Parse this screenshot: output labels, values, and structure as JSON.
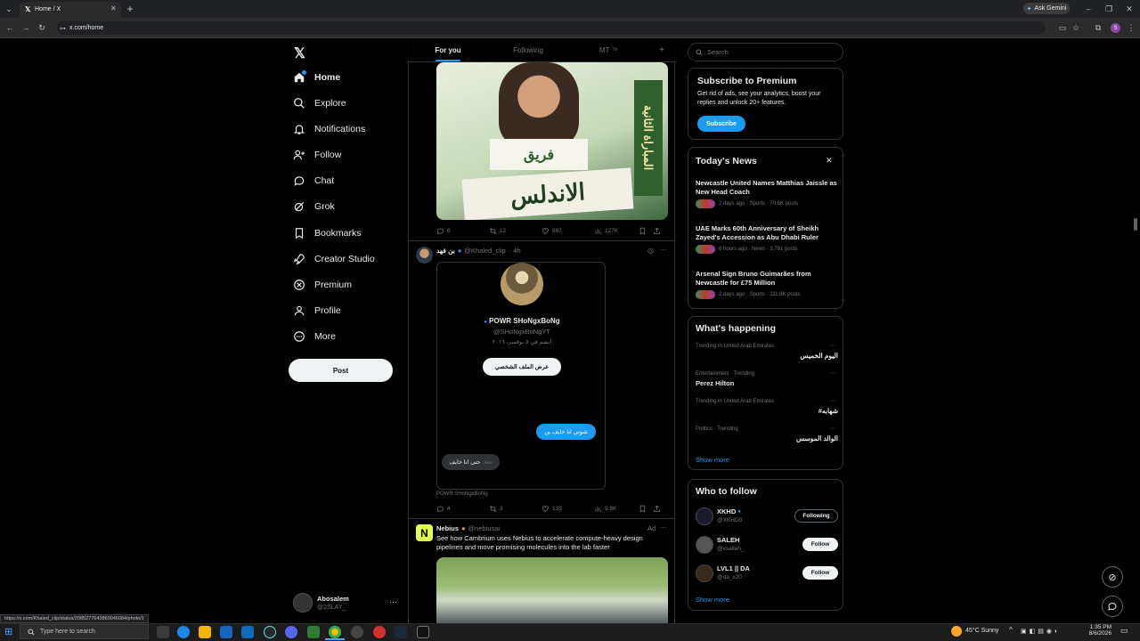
{
  "browser": {
    "tab_title": "Home / X",
    "ask_gemini": "Ask Gemini",
    "url": "x.com/home",
    "status_url": "https://x.com/Khaled_clip/status/2085277643860046084/photo/1"
  },
  "nav": {
    "items": [
      {
        "label": "Home",
        "icon": "home-icon"
      },
      {
        "label": "Explore",
        "icon": "search-icon"
      },
      {
        "label": "Notifications",
        "icon": "bell-icon"
      },
      {
        "label": "Follow",
        "icon": "person-add-icon"
      },
      {
        "label": "Chat",
        "icon": "chat-bubble-icon"
      },
      {
        "label": "Grok",
        "icon": "grok-icon"
      },
      {
        "label": "Bookmarks",
        "icon": "bookmark-icon"
      },
      {
        "label": "Creator Studio",
        "icon": "rocket-icon"
      },
      {
        "label": "Premium",
        "icon": "x-premium-icon"
      },
      {
        "label": "Profile",
        "icon": "person-icon"
      },
      {
        "label": "More",
        "icon": "more-circle-icon"
      }
    ],
    "post_label": "Post",
    "account": {
      "name": "Abosalem",
      "handle": "@2SLAY_"
    }
  },
  "feed": {
    "tabs": [
      {
        "label": "For you",
        "badge": ""
      },
      {
        "label": "Following",
        "badge": ""
      },
      {
        "label": "MT",
        "badge": "Tri"
      }
    ],
    "post1": {
      "image_text_1": "فريق",
      "image_text_2": "الاندلس",
      "image_text_3": "المباراة الثانية",
      "stats": {
        "replies": "6",
        "reposts": "12",
        "likes": "887",
        "views": "127K"
      }
    },
    "post2": {
      "author": "بن فهد",
      "handle": "@Khaled_clip",
      "time": "4h",
      "embed_name": "POWR SHoNgxBoNg",
      "embed_handle": "@SHoNgxBoNgYT",
      "embed_joined": "انضم في ٥ نوفمبر، ٢٠١٦",
      "embed_button": "عرض الملف الشخصي",
      "bubble_sent": "شوتي انا خايف بن",
      "bubble_received": "حتى انا خايف",
      "bubble_meta": "Now",
      "caption": "POWR SHoNgxBoNg",
      "stats": {
        "replies": "4",
        "reposts": "3",
        "likes": "135",
        "views": "9.8K"
      }
    },
    "post3": {
      "author": "Nebius",
      "handle": "@nebiusai",
      "ad_label": "Ad",
      "text": "See how Cambrium uses Nebius to accelerate compute-heavy design pipelines and move promising molecules into the lab faster"
    }
  },
  "sidebar": {
    "search_placeholder": "Search",
    "premium": {
      "title": "Subscribe to Premium",
      "text": "Get rid of ads, see your analytics, boost your replies and unlock 20+ features.",
      "button": "Subscribe"
    },
    "news": {
      "title": "Today's News",
      "items": [
        {
          "headline": "Newcastle United Names Matthias Jaissle as New Head Coach",
          "meta": "2 days ago · Sports · 70.6K posts"
        },
        {
          "headline": "UAE Marks 60th Anniversary of Sheikh Zayed's Accession as Abu Dhabi Ruler",
          "meta": "6 hours ago · News · 3,761 posts"
        },
        {
          "headline": "Arsenal Sign Bruno Guimarães from Newcastle for £75 Million",
          "meta": "2 days ago · Sports · 111.6K posts"
        }
      ]
    },
    "happening": {
      "title": "What's happening",
      "items": [
        {
          "context": "Trending in United Arab Emirates",
          "topic": "اليوم الخميس"
        },
        {
          "context": "Entertainment · Trending",
          "topic": "Perez Hilton"
        },
        {
          "context": "Trending in United Arab Emirates",
          "topic": "#شهابه"
        },
        {
          "context": "Politics · Trending",
          "topic": "الوالد الموسس"
        }
      ],
      "show_more": "Show more"
    },
    "who_to_follow": {
      "title": "Who to follow",
      "users": [
        {
          "name": "XKHD",
          "handle": "@XKHD0",
          "button": "Following"
        },
        {
          "name": "SALEH",
          "handle": "@vsalleh_",
          "button": "Follow"
        },
        {
          "name": "LVL1 || DA",
          "handle": "@da_x20",
          "button": "Follow"
        }
      ],
      "show_more": "Show more"
    }
  },
  "taskbar": {
    "search_placeholder": "Type here to search",
    "weather": "45°C  Sunny",
    "time": "1:35 PM",
    "date": "8/6/2026"
  },
  "colors": {
    "accent": "#1d9bf0",
    "background": "#000000",
    "border": "#2f3336"
  }
}
